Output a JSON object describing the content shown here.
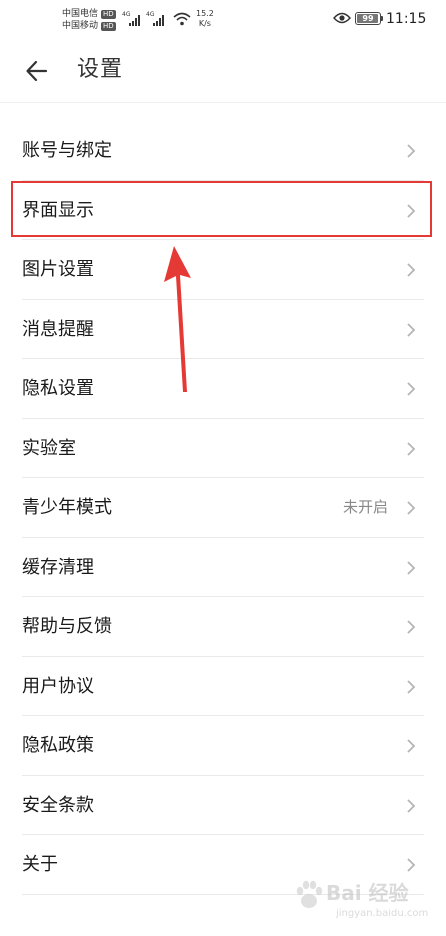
{
  "status_bar": {
    "carrier_1": "中国电信",
    "carrier_2": "中国移动",
    "hd_badge": "HD",
    "network_1": "4G",
    "network_2": "4G",
    "speed_value": "15.2",
    "speed_unit": "K/s",
    "battery_level": "99",
    "time": "11:15",
    "icons": [
      "signal-icon",
      "wifi-icon",
      "eye-icon",
      "battery-icon"
    ]
  },
  "header": {
    "title": "设置",
    "back_icon": "arrow-left-icon"
  },
  "settings": {
    "items": [
      {
        "label": "账号与绑定"
      },
      {
        "label": "界面显示"
      },
      {
        "label": "图片设置"
      },
      {
        "label": "消息提醒"
      },
      {
        "label": "隐私设置"
      },
      {
        "label": "实验室"
      },
      {
        "label": "青少年模式",
        "value": "未开启"
      },
      {
        "label": "缓存清理"
      },
      {
        "label": "帮助与反馈"
      },
      {
        "label": "用户协议"
      },
      {
        "label": "隐私政策"
      },
      {
        "label": "安全条款"
      },
      {
        "label": "关于"
      }
    ],
    "highlighted_index": 1
  },
  "annotation": {
    "highlight_color": "#e53935",
    "arrow_color": "#e53935"
  },
  "colors": {
    "background": "#ffffff",
    "text_primary": "#1a1a1a",
    "text_secondary": "#888888",
    "divider": "#e9e9e9"
  },
  "watermark": {
    "main": "Bai 经验",
    "sub": "jingyan.baidu.com"
  }
}
